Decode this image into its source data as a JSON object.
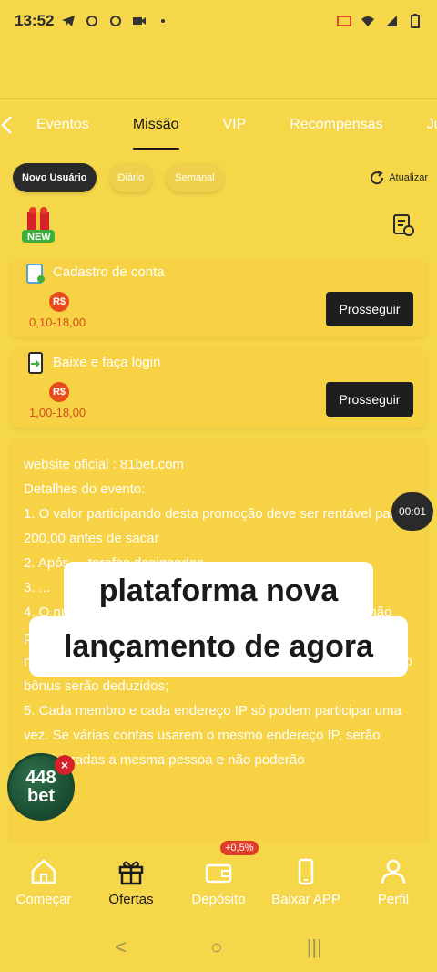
{
  "status": {
    "time": "13:52"
  },
  "tabs": {
    "items": [
      "Eventos",
      "Missão",
      "VIP",
      "Recompensas",
      "Juro"
    ],
    "active_index": 1
  },
  "filters": {
    "items": [
      "Novo Usuário",
      "Diário",
      "Semanal"
    ],
    "refresh_label": "Atualizar"
  },
  "new_badge": "NEW",
  "missions": [
    {
      "title": "Cadastro de conta",
      "currency": "R$",
      "range": "0,10-18,00",
      "button": "Prosseguir",
      "icon": "clipboard-icon"
    },
    {
      "title": "Baixe e faça login",
      "currency": "R$",
      "range": "1,00-18,00",
      "button": "Prosseguir",
      "icon": "phone-download-icon"
    }
  ],
  "details": {
    "lines": [
      "website oficial : 81bet.com",
      "Detalhes do evento:",
      "1. O valor participando desta promoção deve ser rentável para 200,00 antes de sacar",
      "2. Após ... tarefas designadas ...",
      "3. ...",
      "4. O número da conta bancária e quaisquer informações não podem ser alterados antes do primeiro pedido de saque. Se for necessário modificar, o bônus de presente e o lucro gerado pelo bônus serão deduzidos;",
      "5. Cada membro e cada endereço IP só podem participar uma vez. Se várias contas usarem o mesmo endereço IP, serão consideradas a mesma pessoa e não poderão"
    ]
  },
  "timer": "00:01",
  "overlay": {
    "line1": "plataforma nova",
    "line2": "lançamento de agora"
  },
  "floating_badge": {
    "top": "448",
    "bottom": "bet",
    "close": "×"
  },
  "bottom_nav": {
    "items": [
      {
        "label": "Começar",
        "icon": "home-icon"
      },
      {
        "label": "Ofertas",
        "icon": "gift-icon"
      },
      {
        "label": "Depósito",
        "icon": "wallet-icon"
      },
      {
        "label": "Baixar APP",
        "icon": "phone-icon"
      },
      {
        "label": "Perfil",
        "icon": "user-icon"
      }
    ],
    "active_index": 1,
    "promo_badge": "+0,5%"
  },
  "system_nav": {
    "back": "<",
    "home": "○",
    "recents": "|||"
  }
}
